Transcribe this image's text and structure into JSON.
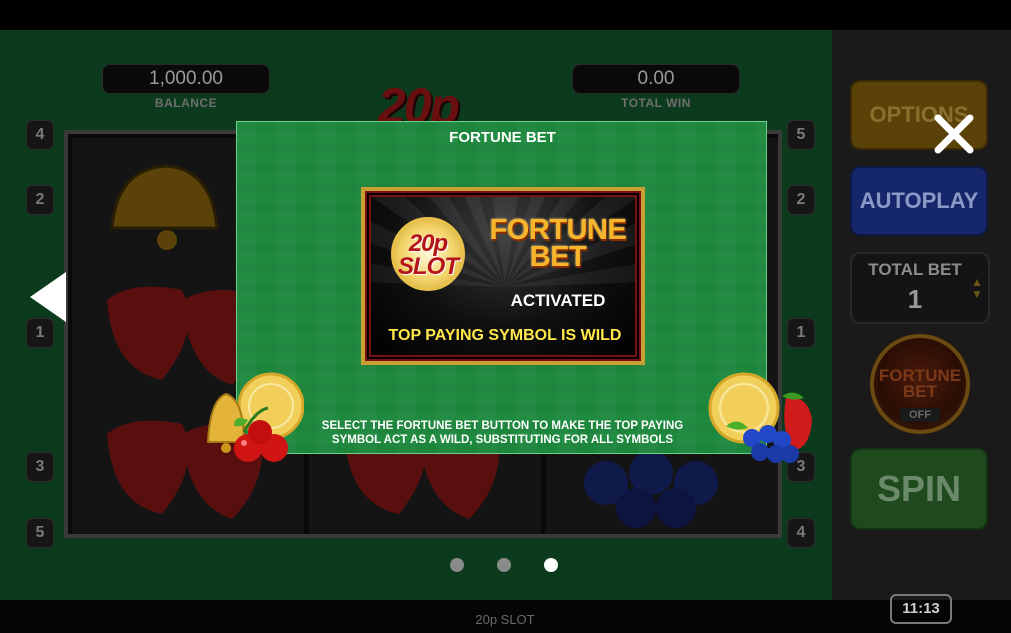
{
  "header": {
    "balance_value": "1,000.00",
    "balance_label": "BALANCE",
    "total_win_value": "0.00",
    "total_win_label": "TOTAL WIN",
    "game_logo": "20p SLOT"
  },
  "paylines": {
    "left": [
      "4",
      "2",
      "1",
      "3",
      "5"
    ],
    "right": [
      "5",
      "2",
      "1",
      "3",
      "4"
    ]
  },
  "side_panel": {
    "options_label": "OPTIONS",
    "autoplay_label": "AUTOPLAY",
    "total_bet_label": "TOTAL BET",
    "total_bet_value": "1",
    "fortune_bet_title": "FORTUNE BET",
    "fortune_bet_state": "OFF",
    "spin_label": "SPIN"
  },
  "info_panel": {
    "title": "FORTUNE BET",
    "card_logo": "20p SLOT",
    "card_heading": "FORTUNE BET",
    "card_status": "ACTIVATED",
    "card_rule": "TOP PAYING SYMBOL IS WILD",
    "description": "SELECT THE FORTUNE BET BUTTON TO MAKE THE TOP PAYING SYMBOL ACT AS A WILD, SUBSTITUTING FOR ALL SYMBOLS"
  },
  "pagination": {
    "total_pages": 3,
    "active_page": 3
  },
  "footer": {
    "game_name": "20p SLOT",
    "clock": "11:13"
  },
  "icons": {
    "nav_prev": "left-arrow-icon",
    "close": "close-icon"
  },
  "colors": {
    "panel_green": "#1f8a3f",
    "gold_border": "#c9a034",
    "wild_yellow": "#ffe84a",
    "fortune_orange": "#f7b52c"
  }
}
